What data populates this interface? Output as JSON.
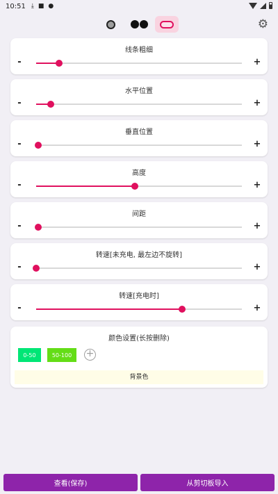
{
  "status_bar": {
    "time": "10:51"
  },
  "settings_icon": "gear-icon",
  "sliders": [
    {
      "id": "line-thickness",
      "label": "线条粗细",
      "value_fraction": 0.11
    },
    {
      "id": "horizontal-position",
      "label": "水平位置",
      "value_fraction": 0.07
    },
    {
      "id": "vertical-position",
      "label": "垂直位置",
      "value_fraction": 0.01
    },
    {
      "id": "height",
      "label": "高度",
      "value_fraction": 0.48
    },
    {
      "id": "spacing",
      "label": "间距",
      "value_fraction": 0.01
    },
    {
      "id": "rotation-speed-discharging",
      "label": "转速[未充电, 最左边不旋转]",
      "value_fraction": 0.0
    },
    {
      "id": "rotation-speed-charging",
      "label": "转速[充电时]",
      "value_fraction": 0.71
    }
  ],
  "slider_controls": {
    "minus": "-",
    "plus": "+"
  },
  "color_settings": {
    "title": "颜色设置(长按删除)",
    "swatches": [
      {
        "label": "0-50",
        "color": "#00e676"
      },
      {
        "label": "50-100",
        "color": "#64dd17"
      }
    ],
    "add_symbol": "+",
    "background_label": "背景色"
  },
  "buttons": {
    "view_save": "查看(保存)",
    "import_clipboard": "从剪切板导入"
  },
  "colors": {
    "accent": "#e0105e",
    "button": "#8e24aa"
  }
}
